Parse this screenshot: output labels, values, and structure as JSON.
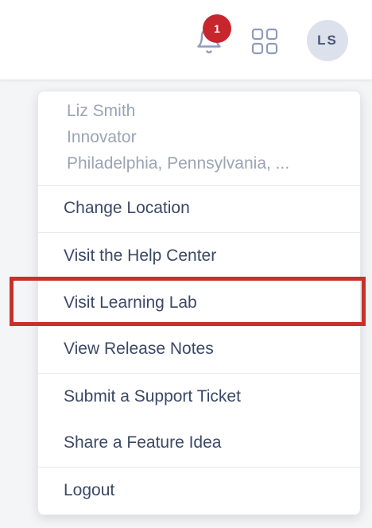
{
  "header": {
    "notification_count": "1",
    "avatar_initials": "LS",
    "icons": [
      "bell-icon",
      "apps-grid-icon"
    ],
    "colors": {
      "badge": "#c8262d",
      "avatar_bg": "#dde1ec",
      "highlight": "#c7302b"
    }
  },
  "user_menu": {
    "profile": {
      "name": "Liz Smith",
      "role": "Innovator",
      "location": "Philadelphia, Pennsylvania, ..."
    },
    "items": [
      {
        "label": "Change Location"
      },
      {
        "label": "Visit the Help Center"
      },
      {
        "label": "Visit Learning Lab",
        "highlighted": true
      },
      {
        "label": "View Release Notes"
      },
      {
        "label": "Submit a Support Ticket"
      },
      {
        "label": "Share a Feature Idea"
      },
      {
        "label": "Logout"
      }
    ]
  }
}
